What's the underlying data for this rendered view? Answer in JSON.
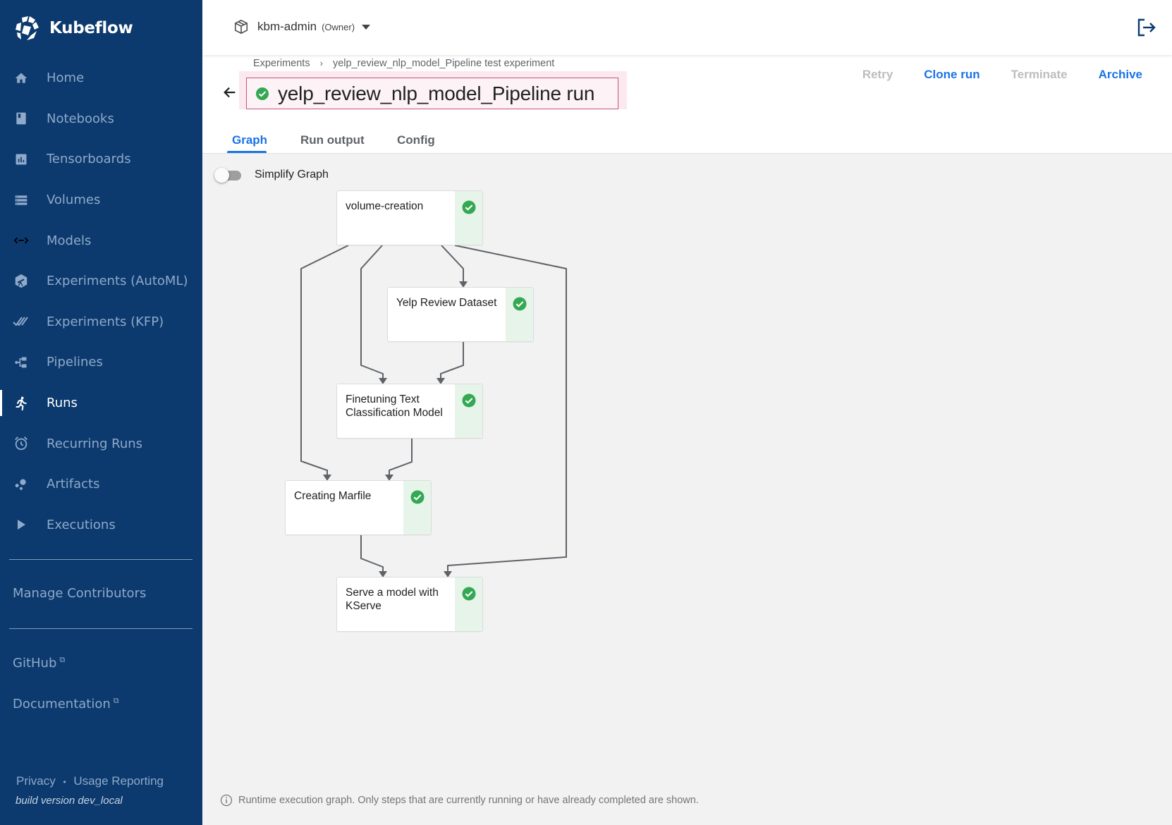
{
  "brand": {
    "name": "Kubeflow"
  },
  "sidebar": {
    "items": [
      {
        "label": "Home",
        "icon": "home-icon"
      },
      {
        "label": "Notebooks",
        "icon": "notebook-icon"
      },
      {
        "label": "Tensorboards",
        "icon": "bar-chart-icon"
      },
      {
        "label": "Volumes",
        "icon": "storage-icon"
      },
      {
        "label": "Models",
        "icon": "code-arrows-icon"
      },
      {
        "label": "Experiments (AutoML)",
        "icon": "telescope-icon"
      },
      {
        "label": "Experiments (KFP)",
        "icon": "done-all-icon"
      },
      {
        "label": "Pipelines",
        "icon": "pipeline-icon"
      },
      {
        "label": "Runs",
        "icon": "running-person-icon",
        "active": true
      },
      {
        "label": "Recurring Runs",
        "icon": "alarm-icon"
      },
      {
        "label": "Artifacts",
        "icon": "bubbles-icon"
      },
      {
        "label": "Executions",
        "icon": "play-icon"
      }
    ],
    "manage_contributors": "Manage Contributors",
    "github": "GitHub",
    "documentation": "Documentation",
    "privacy": "Privacy",
    "dot": "•",
    "usage_reporting": "Usage Reporting",
    "build_version": "build version dev_local"
  },
  "header": {
    "namespace": "kbm-admin",
    "role": "(Owner)"
  },
  "page": {
    "breadcrumbs": [
      "Experiments",
      "yelp_review_nlp_model_Pipeline test experiment"
    ],
    "breadcrumb_separator": "›",
    "title": "yelp_review_nlp_model_Pipeline run",
    "status": "succeeded",
    "actions": [
      {
        "label": "Retry",
        "enabled": false
      },
      {
        "label": "Clone run",
        "enabled": true
      },
      {
        "label": "Terminate",
        "enabled": false
      },
      {
        "label": "Archive",
        "enabled": true
      }
    ]
  },
  "tabs": [
    {
      "label": "Graph",
      "active": true
    },
    {
      "label": "Run output",
      "active": false
    },
    {
      "label": "Config",
      "active": false
    }
  ],
  "graph": {
    "simplify_label": "Simplify Graph",
    "simplify_enabled": false,
    "nodes": [
      {
        "id": "volume-creation",
        "label": "volume-creation",
        "status": "succeeded"
      },
      {
        "id": "yelp-review-dataset",
        "label": "Yelp Review Dataset",
        "status": "succeeded"
      },
      {
        "id": "finetuning",
        "label": "Finetuning Text Classification Model",
        "status": "succeeded"
      },
      {
        "id": "creating-marfile",
        "label": "Creating Marfile",
        "status": "succeeded"
      },
      {
        "id": "serve-model",
        "label": "Serve a model with KServe",
        "status": "succeeded"
      }
    ],
    "edges": [
      [
        "volume-creation",
        "yelp-review-dataset"
      ],
      [
        "volume-creation",
        "finetuning"
      ],
      [
        "yelp-review-dataset",
        "finetuning"
      ],
      [
        "volume-creation",
        "creating-marfile"
      ],
      [
        "finetuning",
        "creating-marfile"
      ],
      [
        "creating-marfile",
        "serve-model"
      ],
      [
        "volume-creation",
        "serve-model"
      ]
    ],
    "hint": "Runtime execution graph. Only steps that are currently running or have already completed are shown."
  },
  "colors": {
    "sidebar_bg": "#0c3a6e",
    "accent": "#1a73e8",
    "success": "#34a853",
    "success_strip": "#e6f4ea",
    "title_highlight": "#c6537e"
  }
}
